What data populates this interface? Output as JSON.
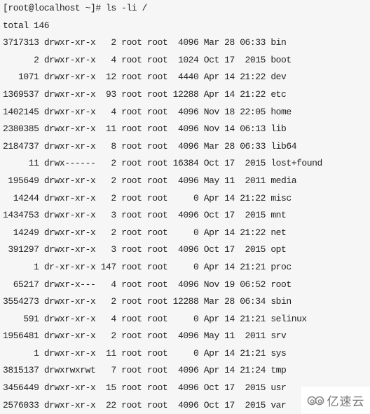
{
  "prompt": {
    "text": "[root@localhost ~]# ls -li /"
  },
  "total": "total 146",
  "entries": [
    {
      "inode": "3717313",
      "perms": "drwxr-xr-x",
      "links": "2",
      "owner": "root",
      "group": "root",
      "size": "4096",
      "month": "Mar",
      "day": "28",
      "time": "06:33",
      "name": "bin"
    },
    {
      "inode": "2",
      "perms": "drwxr-xr-x",
      "links": "4",
      "owner": "root",
      "group": "root",
      "size": "1024",
      "month": "Oct",
      "day": "17",
      "time": "2015",
      "name": "boot"
    },
    {
      "inode": "1071",
      "perms": "drwxr-xr-x",
      "links": "12",
      "owner": "root",
      "group": "root",
      "size": "4440",
      "month": "Apr",
      "day": "14",
      "time": "21:22",
      "name": "dev"
    },
    {
      "inode": "1369537",
      "perms": "drwxr-xr-x",
      "links": "93",
      "owner": "root",
      "group": "root",
      "size": "12288",
      "month": "Apr",
      "day": "14",
      "time": "21:22",
      "name": "etc"
    },
    {
      "inode": "1402145",
      "perms": "drwxr-xr-x",
      "links": "4",
      "owner": "root",
      "group": "root",
      "size": "4096",
      "month": "Nov",
      "day": "18",
      "time": "22:05",
      "name": "home"
    },
    {
      "inode": "2380385",
      "perms": "drwxr-xr-x",
      "links": "11",
      "owner": "root",
      "group": "root",
      "size": "4096",
      "month": "Nov",
      "day": "14",
      "time": "06:13",
      "name": "lib"
    },
    {
      "inode": "2184737",
      "perms": "drwxr-xr-x",
      "links": "8",
      "owner": "root",
      "group": "root",
      "size": "4096",
      "month": "Mar",
      "day": "28",
      "time": "06:33",
      "name": "lib64"
    },
    {
      "inode": "11",
      "perms": "drwx------",
      "links": "2",
      "owner": "root",
      "group": "root",
      "size": "16384",
      "month": "Oct",
      "day": "17",
      "time": "2015",
      "name": "lost+found"
    },
    {
      "inode": "195649",
      "perms": "drwxr-xr-x",
      "links": "2",
      "owner": "root",
      "group": "root",
      "size": "4096",
      "month": "May",
      "day": "11",
      "time": "2011",
      "name": "media"
    },
    {
      "inode": "14244",
      "perms": "drwxr-xr-x",
      "links": "2",
      "owner": "root",
      "group": "root",
      "size": "0",
      "month": "Apr",
      "day": "14",
      "time": "21:22",
      "name": "misc"
    },
    {
      "inode": "1434753",
      "perms": "drwxr-xr-x",
      "links": "3",
      "owner": "root",
      "group": "root",
      "size": "4096",
      "month": "Oct",
      "day": "17",
      "time": "2015",
      "name": "mnt"
    },
    {
      "inode": "14249",
      "perms": "drwxr-xr-x",
      "links": "2",
      "owner": "root",
      "group": "root",
      "size": "0",
      "month": "Apr",
      "day": "14",
      "time": "21:22",
      "name": "net"
    },
    {
      "inode": "391297",
      "perms": "drwxr-xr-x",
      "links": "3",
      "owner": "root",
      "group": "root",
      "size": "4096",
      "month": "Oct",
      "day": "17",
      "time": "2015",
      "name": "opt"
    },
    {
      "inode": "1",
      "perms": "dr-xr-xr-x",
      "links": "147",
      "owner": "root",
      "group": "root",
      "size": "0",
      "month": "Apr",
      "day": "14",
      "time": "21:21",
      "name": "proc"
    },
    {
      "inode": "65217",
      "perms": "drwxr-x---",
      "links": "4",
      "owner": "root",
      "group": "root",
      "size": "4096",
      "month": "Nov",
      "day": "19",
      "time": "06:52",
      "name": "root"
    },
    {
      "inode": "3554273",
      "perms": "drwxr-xr-x",
      "links": "2",
      "owner": "root",
      "group": "root",
      "size": "12288",
      "month": "Mar",
      "day": "28",
      "time": "06:34",
      "name": "sbin"
    },
    {
      "inode": "591",
      "perms": "drwxr-xr-x",
      "links": "4",
      "owner": "root",
      "group": "root",
      "size": "0",
      "month": "Apr",
      "day": "14",
      "time": "21:21",
      "name": "selinux"
    },
    {
      "inode": "1956481",
      "perms": "drwxr-xr-x",
      "links": "2",
      "owner": "root",
      "group": "root",
      "size": "4096",
      "month": "May",
      "day": "11",
      "time": "2011",
      "name": "srv"
    },
    {
      "inode": "1",
      "perms": "drwxr-xr-x",
      "links": "11",
      "owner": "root",
      "group": "root",
      "size": "0",
      "month": "Apr",
      "day": "14",
      "time": "21:21",
      "name": "sys"
    },
    {
      "inode": "3815137",
      "perms": "drwxrwxrwt",
      "links": "7",
      "owner": "root",
      "group": "root",
      "size": "4096",
      "month": "Apr",
      "day": "14",
      "time": "21:24",
      "name": "tmp"
    },
    {
      "inode": "3456449",
      "perms": "drwxr-xr-x",
      "links": "15",
      "owner": "root",
      "group": "root",
      "size": "4096",
      "month": "Oct",
      "day": "17",
      "time": "2015",
      "name": "usr"
    },
    {
      "inode": "2576033",
      "perms": "drwxr-xr-x",
      "links": "22",
      "owner": "root",
      "group": "root",
      "size": "4096",
      "month": "Oct",
      "day": "17",
      "time": "2015",
      "name": "var"
    }
  ],
  "watermark": {
    "icon": "cloud-logo-icon",
    "text": "亿速云"
  },
  "colors": {
    "background": "#f6f6f6",
    "text": "#222222",
    "watermark_text": "#777777"
  }
}
